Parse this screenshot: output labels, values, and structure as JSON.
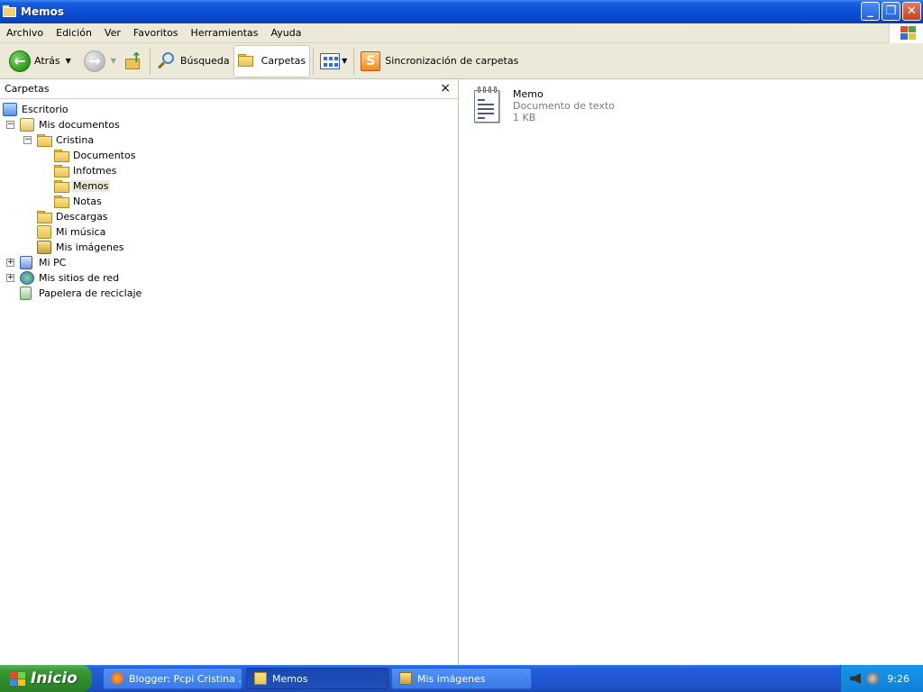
{
  "window": {
    "title": "Memos"
  },
  "menu": [
    "Archivo",
    "Edición",
    "Ver",
    "Favoritos",
    "Herramientas",
    "Ayuda"
  ],
  "toolbar": {
    "back_label": "Atrás",
    "search_label": "Búsqueda",
    "folders_label": "Carpetas",
    "sync_label": "Sincronización de carpetas"
  },
  "folders_pane": {
    "title": "Carpetas",
    "close_glyph": "×",
    "nodes": [
      {
        "label": "Escritorio",
        "icon": "desktop-icon"
      },
      {
        "label": "Mis documentos",
        "icon": "my-documents-icon",
        "expander": "−"
      },
      {
        "label": "Cristina",
        "icon": "folder-icon",
        "expander": "−"
      },
      {
        "label": "Documentos",
        "icon": "folder-icon"
      },
      {
        "label": "Infotmes",
        "icon": "folder-icon"
      },
      {
        "label": "Memos",
        "icon": "folder-icon",
        "selected": true
      },
      {
        "label": "Notas",
        "icon": "folder-icon"
      },
      {
        "label": "Descargas",
        "icon": "folder-icon"
      },
      {
        "label": "Mi música",
        "icon": "my-music-icon"
      },
      {
        "label": "Mis imágenes",
        "icon": "my-pictures-icon"
      },
      {
        "label": "Mi PC",
        "icon": "my-computer-icon",
        "expander": "+"
      },
      {
        "label": "Mis sitios de red",
        "icon": "network-places-icon",
        "expander": "+"
      },
      {
        "label": "Papelera de reciclaje",
        "icon": "recycle-bin-icon"
      }
    ]
  },
  "files": [
    {
      "name": "Memo",
      "type": "Documento de texto",
      "size": "1 KB",
      "icon": "text-document-icon"
    }
  ],
  "taskbar": {
    "start_label": "Inicio",
    "tasks": [
      {
        "label": "Blogger: Pcpi Cristina ...",
        "icon": "firefox-icon"
      },
      {
        "label": "Memos",
        "icon": "folder-icon",
        "active": true
      },
      {
        "label": "Mis imágenes",
        "icon": "my-pictures-icon"
      }
    ],
    "clock": "9:26"
  },
  "colors": {
    "titlebar_blue": "#0b4fd8",
    "taskbar_blue": "#245edb",
    "start_green": "#3a9a36",
    "chrome_beige": "#ece9d8"
  }
}
